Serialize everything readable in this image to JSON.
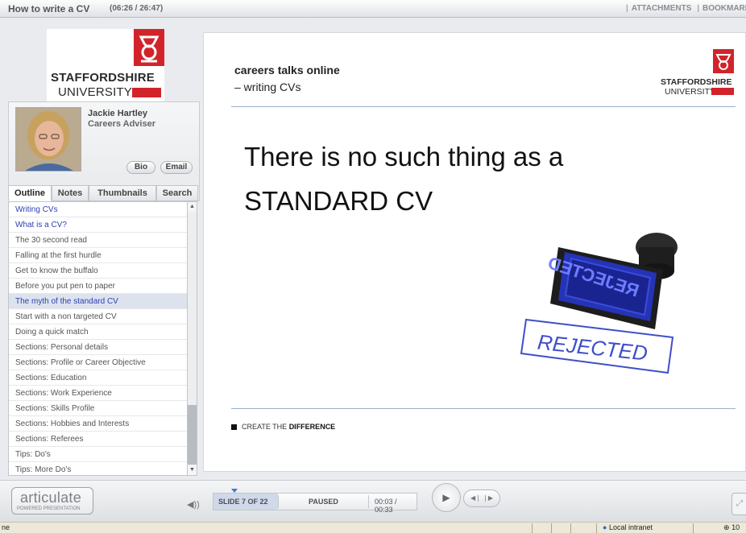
{
  "header": {
    "title": "How to write a CV",
    "time": "(06:26 / 26:47)",
    "links": [
      "ATTACHMENTS",
      "BOOKMARK"
    ]
  },
  "logo": {
    "line1": "STAFFORDSHIRE",
    "line2": "UNIVERSITY",
    "accent": "#d2232a"
  },
  "presenter": {
    "name": "Jackie Hartley",
    "role": "Careers Adviser",
    "bio_label": "Bio",
    "email_label": "Email"
  },
  "tabs": [
    "Outline",
    "Notes",
    "Thumbnails",
    "Search"
  ],
  "outline": [
    "Writing CVs",
    "What is a CV?",
    "The 30 second read",
    "Falling at the first hurdle",
    "Get to know the buffalo",
    "Before you put pen to paper",
    "The myth of the standard CV",
    "Start with a non targeted CV",
    "Doing a quick match",
    "Sections: Personal details",
    "Sections: Profile or Career Objective",
    "Sections: Education",
    "Sections: Work Experience",
    "Sections: Skills Profile",
    "Sections: Hobbies and Interests",
    "Sections: Referees",
    "Tips:  Do's",
    "Tips: More Do's"
  ],
  "slide": {
    "heading": "careers talks online",
    "subheading": "– writing CVs",
    "main_line1": "There is no such thing as a",
    "main_line2": "STANDARD CV",
    "stamp_top": "REJECTED",
    "stamp_ink": "REJECTED",
    "footer_prefix": "CREATE THE ",
    "footer_bold": "DIFFERENCE"
  },
  "controls": {
    "brand": "articulate",
    "brand_sub": "POWERED PRESENTATION",
    "slide_counter": "SLIDE 7 OF 22",
    "state": "PAUSED",
    "slide_time": "00:03 / 00:33"
  },
  "windows_status": {
    "left": "ne",
    "zone": "Local intranet",
    "zoom": "10"
  }
}
